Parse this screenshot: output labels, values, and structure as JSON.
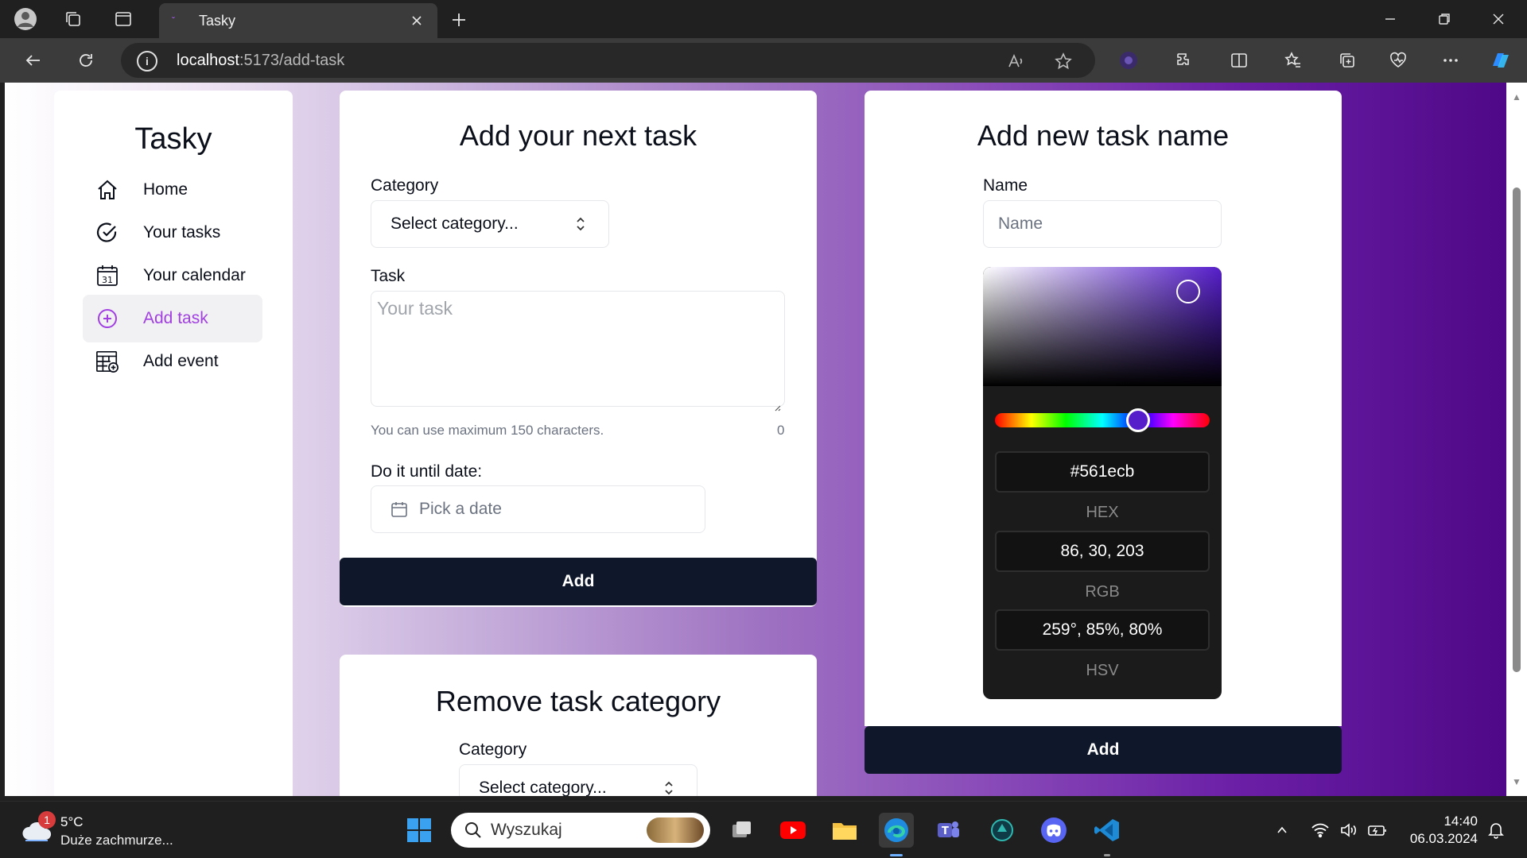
{
  "browser": {
    "tab_title": "Tasky",
    "url_host": "localhost",
    "url_path": ":5173/add-task"
  },
  "sidebar": {
    "brand": "Tasky",
    "items": [
      {
        "label": "Home",
        "icon": "home-icon"
      },
      {
        "label": "Your tasks",
        "icon": "check-circle-icon"
      },
      {
        "label": "Your calendar",
        "icon": "calendar-icon"
      },
      {
        "label": "Add task",
        "icon": "plus-circle-icon",
        "active": true
      },
      {
        "label": "Add event",
        "icon": "calendar-grid-icon"
      }
    ]
  },
  "add_task": {
    "title": "Add your next task",
    "category_label": "Category",
    "category_value": "Select category...",
    "task_label": "Task",
    "task_placeholder": "Your task",
    "hint": "You can use maximum 150 characters.",
    "char_count": "0",
    "date_label": "Do it until date:",
    "date_placeholder": "Pick a date",
    "submit": "Add"
  },
  "remove_category": {
    "title": "Remove task category",
    "category_label": "Category",
    "category_value": "Select category..."
  },
  "add_name": {
    "title": "Add new task name",
    "name_label": "Name",
    "name_placeholder": "Name",
    "submit": "Add",
    "color": {
      "hex": "#561ecb",
      "hex_label": "HEX",
      "rgb": "86, 30, 203",
      "rgb_label": "RGB",
      "hsv": "259°, 85%, 80%",
      "hsv_label": "HSV"
    }
  },
  "taskbar": {
    "weather_badge": "1",
    "temperature": "5°C",
    "weather_desc": "Duże zachmurze...",
    "search_placeholder": "Wyszukaj",
    "time": "14:40",
    "date": "06.03.2024"
  },
  "colors": {
    "accent": "#a13fe0",
    "button_dark": "#0f172a",
    "picker_color": "#561ecb"
  }
}
